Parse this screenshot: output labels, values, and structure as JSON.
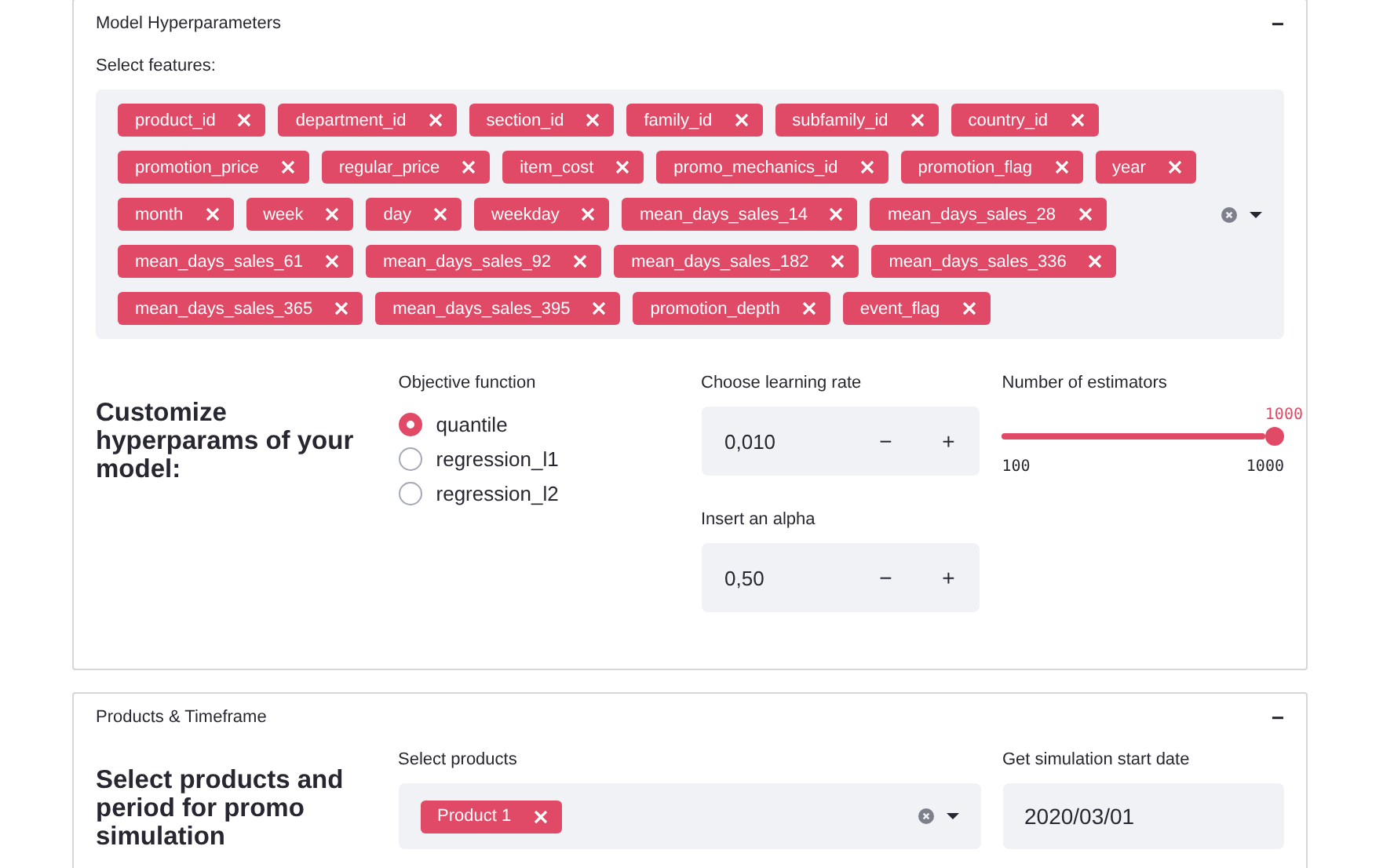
{
  "hyper_panel": {
    "title": "Model Hyperparameters",
    "toggle": "−",
    "features": {
      "label": "Select features:",
      "tags": [
        "product_id",
        "department_id",
        "section_id",
        "family_id",
        "subfamily_id",
        "country_id",
        "promotion_price",
        "regular_price",
        "item_cost",
        "promo_mechanics_id",
        "promotion_flag",
        "year",
        "month",
        "week",
        "day",
        "weekday",
        "mean_days_sales_14",
        "mean_days_sales_28",
        "mean_days_sales_61",
        "mean_days_sales_92",
        "mean_days_sales_182",
        "mean_days_sales_336",
        "mean_days_sales_365",
        "mean_days_sales_395",
        "promotion_depth",
        "event_flag"
      ]
    },
    "heading": "Customize hyperparams of your model:",
    "objective": {
      "label": "Objective function",
      "options": [
        {
          "label": "quantile",
          "selected": true
        },
        {
          "label": "regression_l1",
          "selected": false
        },
        {
          "label": "regression_l2",
          "selected": false
        }
      ]
    },
    "learning_rate": {
      "label": "Choose learning rate",
      "value": "0,010",
      "minus": "−",
      "plus": "+"
    },
    "alpha": {
      "label": "Insert an alpha",
      "value": "0,50",
      "minus": "−",
      "plus": "+"
    },
    "estimators": {
      "label": "Number of estimators",
      "value": "1000",
      "min": "100",
      "max": "1000",
      "level": 1
    }
  },
  "products_panel": {
    "title": "Products & Timeframe",
    "toggle": "−",
    "heading": "Select products and period for promo simulation",
    "products": {
      "label": "Select products",
      "tags": [
        "Product 1"
      ]
    },
    "start_date": {
      "label": "Get simulation start date",
      "value": "2020/03/01"
    }
  }
}
